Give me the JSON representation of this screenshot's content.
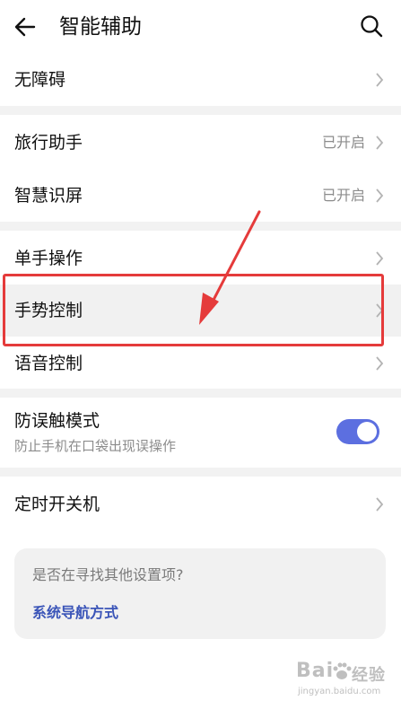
{
  "header": {
    "title": "智能辅助",
    "back_icon": "back-arrow-icon",
    "search_icon": "search-icon"
  },
  "rows": {
    "accessibility": {
      "label": "无障碍"
    },
    "travel_assistant": {
      "label": "旅行助手",
      "status": "已开启"
    },
    "smart_screen": {
      "label": "智慧识屏",
      "status": "已开启"
    },
    "one_hand": {
      "label": "单手操作"
    },
    "gesture_control": {
      "label": "手势控制"
    },
    "voice_control": {
      "label": "语音控制"
    },
    "scheduled_power": {
      "label": "定时开关机"
    }
  },
  "mistouch": {
    "title": "防误触模式",
    "subtitle": "防止手机在口袋出现误操作",
    "enabled": true
  },
  "suggestion": {
    "question": "是否在寻找其他设置项?",
    "link": "系统导航方式"
  },
  "watermark": {
    "brand": "Bai",
    "brand2": "经验",
    "url": "jingyan.baidu.com"
  },
  "colors": {
    "accent": "#5c6fe0",
    "link": "#3b55b8",
    "annotation": "#e53b3b"
  }
}
